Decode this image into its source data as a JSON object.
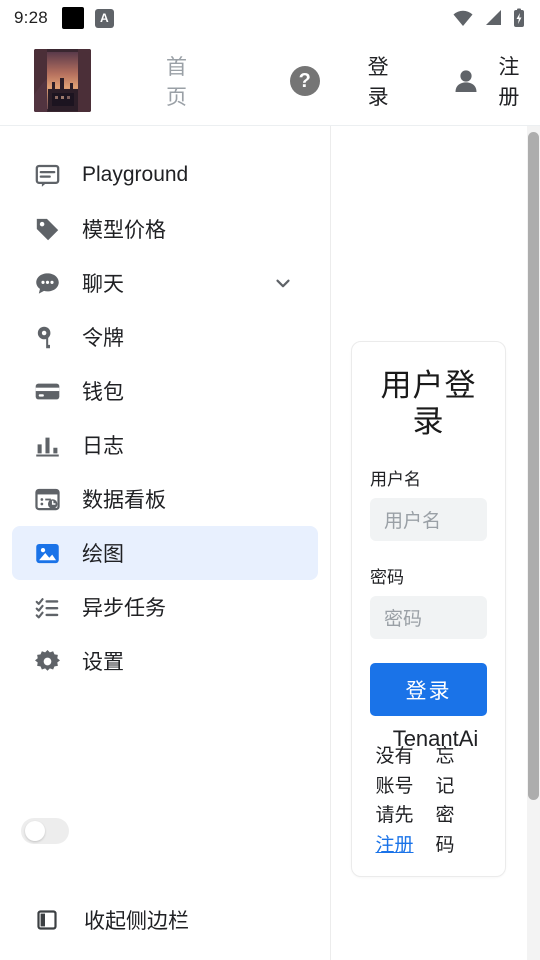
{
  "statusbar": {
    "time": "9:28",
    "a_badge": "A",
    "icons": [
      "notification-square-icon",
      "a-badge-icon",
      "wifi-icon",
      "cellular-signal-icon",
      "battery-charging-icon"
    ]
  },
  "header": {
    "logo_alt": "sunset-cityscape-logo",
    "home_label": "首页",
    "help_label": "?",
    "login_label": "登录",
    "register_label": "注册"
  },
  "sidebar": {
    "items": [
      {
        "label": "Playground",
        "icon": "playground-icon",
        "active": false,
        "expandable": false
      },
      {
        "label": "模型价格",
        "icon": "tag-icon",
        "active": false,
        "expandable": false
      },
      {
        "label": "聊天",
        "icon": "chat-bubble-icon",
        "active": false,
        "expandable": true
      },
      {
        "label": "令牌",
        "icon": "key-icon",
        "active": false,
        "expandable": false
      },
      {
        "label": "钱包",
        "icon": "wallet-card-icon",
        "active": false,
        "expandable": false
      },
      {
        "label": "日志",
        "icon": "bar-chart-icon",
        "active": false,
        "expandable": false
      },
      {
        "label": "数据看板",
        "icon": "dashboard-clock-icon",
        "active": false,
        "expandable": false
      },
      {
        "label": "绘图",
        "icon": "image-icon",
        "active": true,
        "expandable": false
      },
      {
        "label": "异步任务",
        "icon": "checklist-icon",
        "active": false,
        "expandable": false
      },
      {
        "label": "设置",
        "icon": "gear-icon",
        "active": false,
        "expandable": false
      }
    ],
    "theme_toggle_state": "off",
    "collapse_label": "收起侧边栏",
    "collapse_icon": "sidebar-collapse-icon"
  },
  "login_card": {
    "title": "用户登录",
    "username_label": "用户名",
    "username_placeholder": "用户名",
    "username_value": "",
    "password_label": "密码",
    "password_placeholder": "密码",
    "password_value": "",
    "submit_label": "登录",
    "register_prompt_col": [
      "没有",
      "账号",
      "请先"
    ],
    "register_link": "注册",
    "forgot_col": [
      "忘",
      "记",
      "密",
      "码"
    ]
  },
  "footer": {
    "brand": "TenantAi"
  },
  "colors": {
    "accent_blue": "#1a73e8",
    "active_item_bg": "#e8f0fe",
    "text_primary": "#202124",
    "text_muted": "#9aa0a6",
    "input_bg": "#f1f3f4",
    "scrollbar_thumb": "#adadad"
  }
}
